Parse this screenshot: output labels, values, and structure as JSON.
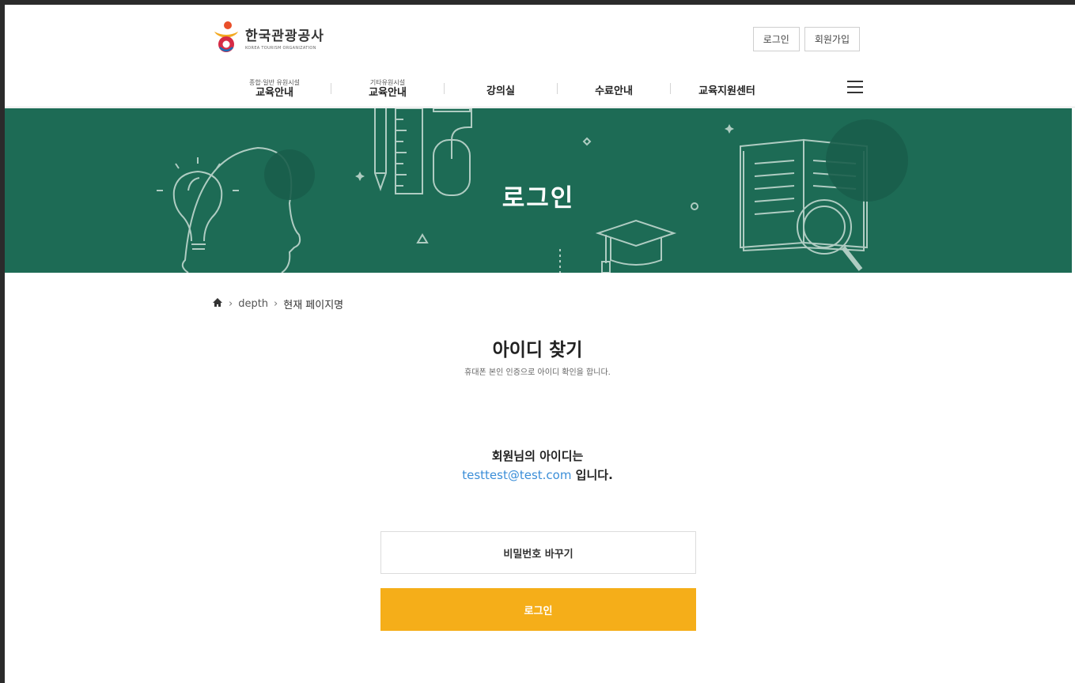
{
  "header": {
    "logo_ko": "한국관광공사",
    "logo_en": "KOREA TOURISM ORGANIZATION",
    "login_label": "로그인",
    "signup_label": "회원가입"
  },
  "gnb": {
    "items": [
      {
        "sub": "종합·일반 유원시설",
        "main": "교육안내"
      },
      {
        "sub": "기타유원시설",
        "main": "교육안내"
      },
      {
        "main": "강의실"
      },
      {
        "main": "수료안내"
      },
      {
        "main": "교육지원센터"
      }
    ],
    "menu_icon": "hamburger-icon"
  },
  "banner": {
    "title": "로그인",
    "background_color": "#1d6b55"
  },
  "breadcrumb": {
    "home_icon": "home-icon",
    "depth": "depth",
    "current": "현재 페이지명"
  },
  "content": {
    "title": "아이디 찾기",
    "description": "휴대폰 본인 인증으로 아이디 확인을 합니다.",
    "result_line1": "회원님의 아이디는",
    "user_id": "testtest@test.com",
    "result_suffix": " 입니다.",
    "change_password_label": "비밀번호 바꾸기",
    "login_button_label": "로그인"
  },
  "colors": {
    "accent": "#f5ae19",
    "link": "#3b8ed8",
    "banner": "#1d6b55"
  }
}
